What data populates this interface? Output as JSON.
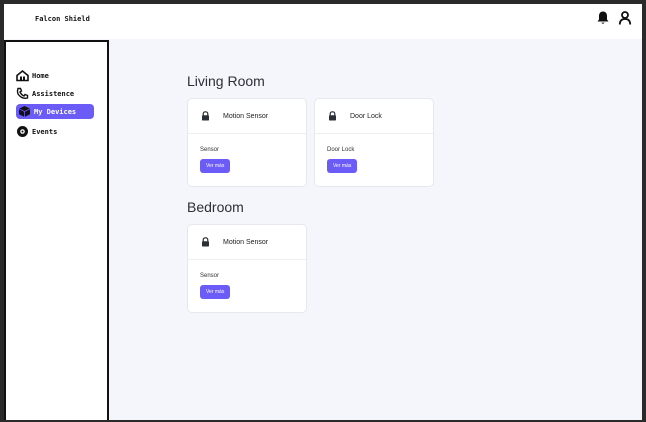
{
  "app": {
    "brand": "Falcon Shield"
  },
  "header": {
    "icons": [
      "bell-icon",
      "user-icon"
    ]
  },
  "sidebar": {
    "items": [
      {
        "label": "Home",
        "icon": "home-icon",
        "active": false
      },
      {
        "label": "Assistence",
        "icon": "phone-icon",
        "active": false
      },
      {
        "label": "My Devices",
        "icon": "box-icon",
        "active": true
      },
      {
        "label": "Events",
        "icon": "camera-icon",
        "active": false
      }
    ]
  },
  "rooms": [
    {
      "name": "Living Room",
      "devices": [
        {
          "name": "Motion Sensor",
          "type": "Sensor",
          "button": "Ver más"
        },
        {
          "name": "Door Lock",
          "type": "Door Lock",
          "button": "Ver más"
        }
      ]
    },
    {
      "name": "Bedroom",
      "devices": [
        {
          "name": "Motion Sensor",
          "type": "Sensor",
          "button": "Ver más"
        }
      ]
    }
  ],
  "colors": {
    "accent": "#6b5bf7",
    "background": "#f4f6fb"
  }
}
